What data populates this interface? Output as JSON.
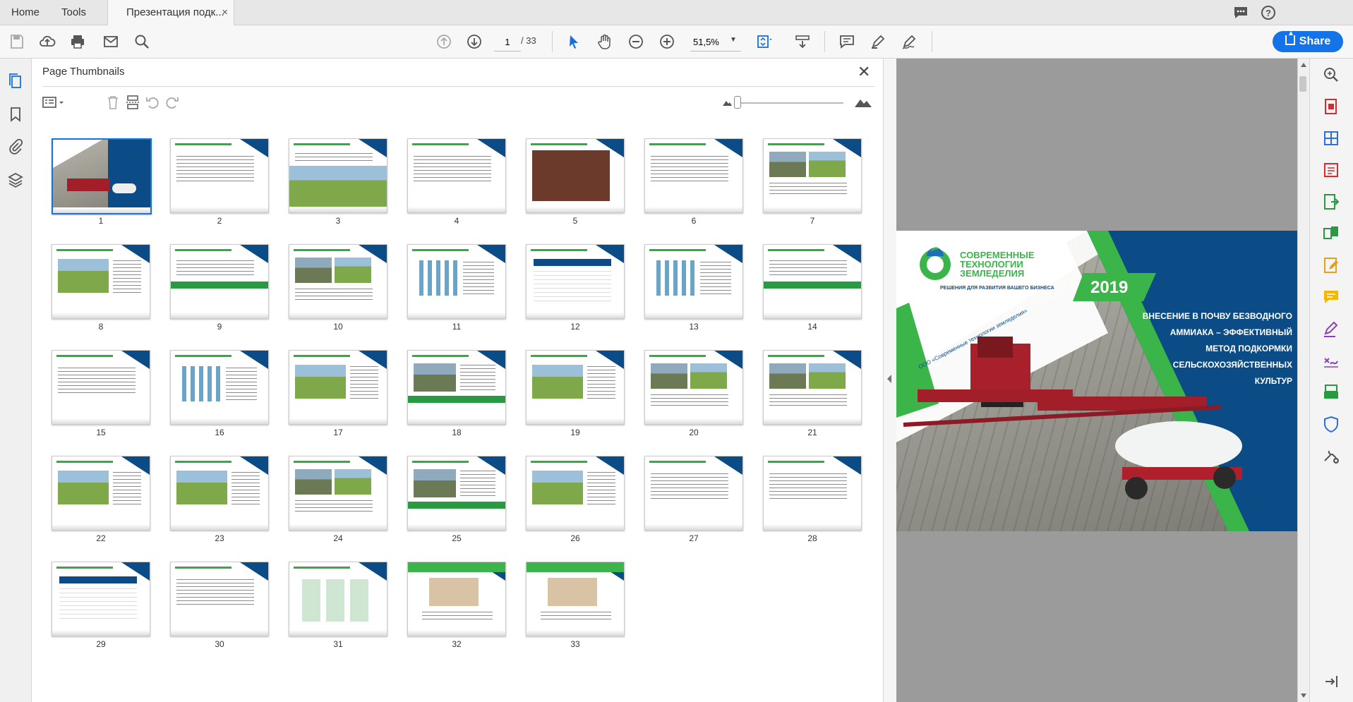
{
  "tabs": {
    "home": "Home",
    "tools": "Tools",
    "document": "Презентация подк...",
    "close": "×"
  },
  "toolbar": {
    "page_current": "1",
    "page_total": "/ 33",
    "zoom": "51,5%",
    "share_label": "Share"
  },
  "panel": {
    "title": "Page Thumbnails",
    "close": "✕"
  },
  "thumbnails": [
    "1",
    "2",
    "3",
    "4",
    "5",
    "6",
    "7",
    "8",
    "9",
    "10",
    "11",
    "12",
    "13",
    "14",
    "15",
    "16",
    "17",
    "18",
    "19",
    "20",
    "21",
    "22",
    "23",
    "24",
    "25",
    "26",
    "27",
    "28",
    "29",
    "30",
    "31",
    "32",
    "33"
  ],
  "slide": {
    "logo_line1": "СОВРЕМЕННЫЕ",
    "logo_line2": "ТЕХНОЛОГИИ",
    "logo_line3": "ЗЕМЛЕДЕЛИЯ",
    "logo_tagline": "РЕШЕНИЯ ДЛЯ РАЗВИТИЯ ВАШЕГО БИЗНЕСА",
    "year": "2019",
    "title_lines": [
      "ВНЕСЕНИЕ В ПОЧВУ БЕЗВОДНОГО",
      "АММИАКА – ЭФФЕКТИВНЫЙ",
      "МЕТОД ПОДКОРМКИ",
      "СЕЛЬСКОХОЗЯЙСТВЕННЫХ",
      "КУЛЬТУР"
    ],
    "diag_text": "ООО «Современные технологии земледелия»"
  },
  "colors": {
    "accent": "#1473e6",
    "brand_green": "#3bb54a",
    "brand_navy": "#0c4c86"
  }
}
